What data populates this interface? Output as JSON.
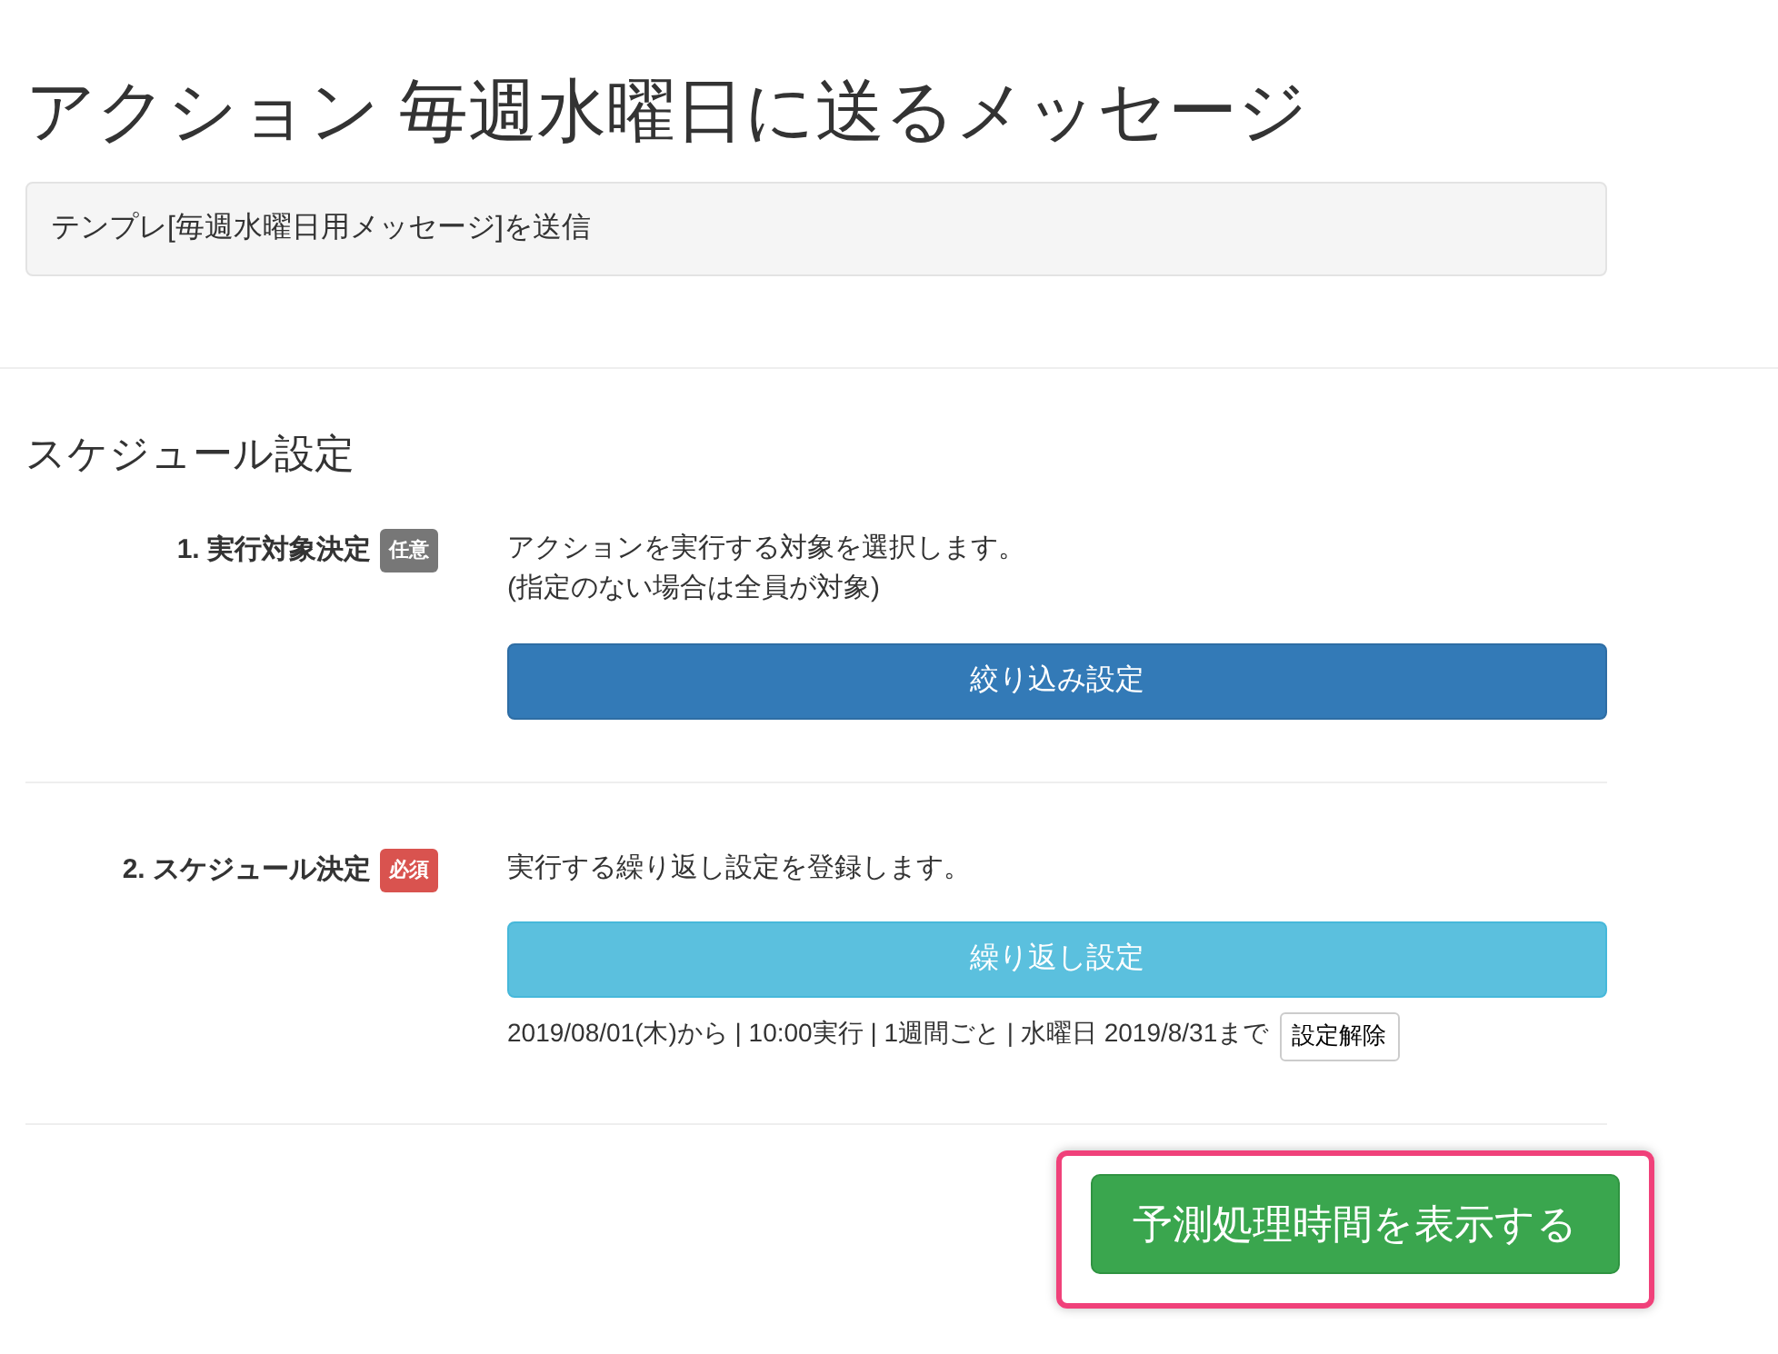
{
  "title": "アクション 毎週水曜日に送るメッセージ",
  "summary": "テンプレ[毎週水曜日用メッセージ]を送信",
  "section_title": "スケジュール設定",
  "steps": [
    {
      "label": "1. 実行対象決定",
      "badge": {
        "text": "任意",
        "kind": "optional"
      },
      "description": [
        "アクションを実行する対象を選択します。",
        "(指定のない場合は全員が対象)"
      ],
      "button": {
        "label": "絞り込み設定",
        "kind": "primary"
      }
    },
    {
      "label": "2. スケジュール決定",
      "badge": {
        "text": "必須",
        "kind": "required"
      },
      "description": [
        "実行する繰り返し設定を登録します。"
      ],
      "button": {
        "label": "繰り返し設定",
        "kind": "info"
      },
      "schedule": {
        "text": "2019/08/01(木)から | 10:00実行 | 1週間ごと | 水曜日 2019/8/31まで",
        "clear_button": "設定解除"
      }
    }
  ],
  "submit": {
    "label": "予測処理時間を表示する",
    "highlighted": true
  }
}
